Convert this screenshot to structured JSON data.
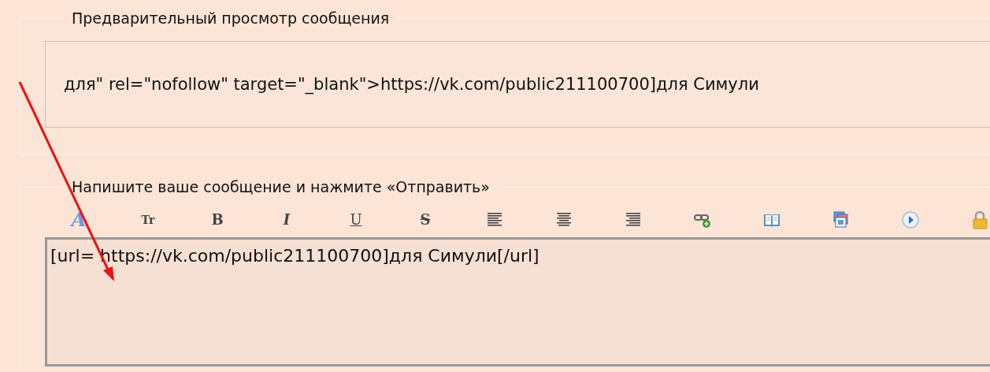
{
  "preview": {
    "legend": "Предварительный просмотр сообщения",
    "text": "для\" rel=\"nofollow\" target=\"_blank\">https://vk.com/public211100700]для Симули"
  },
  "compose": {
    "legend": "Напишите ваше сообщение и нажмите «Отправить»",
    "toolbar": [
      {
        "kind": "color",
        "label": "A"
      },
      {
        "kind": "size",
        "label": "Tr"
      },
      {
        "kind": "bold",
        "label": "B"
      },
      {
        "kind": "italic",
        "label": "I"
      },
      {
        "kind": "underline",
        "label": "U"
      },
      {
        "kind": "strike",
        "label": "S"
      },
      {
        "kind": "align-left"
      },
      {
        "kind": "align-center"
      },
      {
        "kind": "align-right"
      },
      {
        "kind": "link"
      },
      {
        "kind": "book"
      },
      {
        "kind": "images"
      },
      {
        "kind": "play"
      },
      {
        "kind": "lock"
      }
    ],
    "value": "[url= https://vk.com/public211100700]для Симули[/url]"
  }
}
